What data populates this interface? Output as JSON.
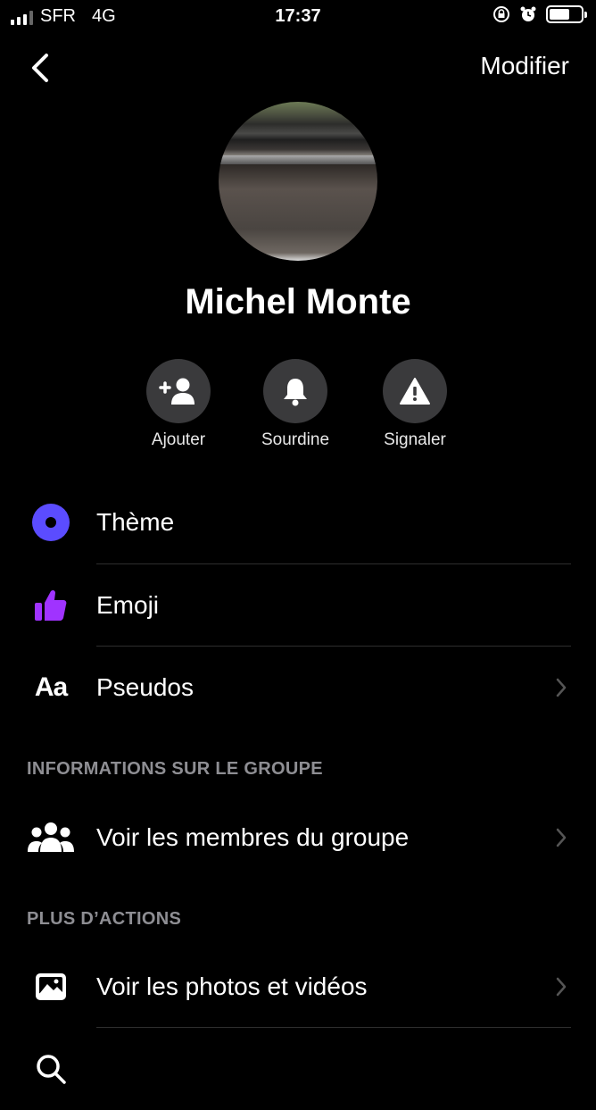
{
  "status_bar": {
    "carrier": "SFR",
    "network": "4G",
    "time": "17:37"
  },
  "nav": {
    "edit_label": "Modifier"
  },
  "profile": {
    "name": "Michel Monte"
  },
  "actions": [
    {
      "label": "Ajouter",
      "icon": "add-person-icon"
    },
    {
      "label": "Sourdine",
      "icon": "bell-icon"
    },
    {
      "label": "Signaler",
      "icon": "warning-icon"
    }
  ],
  "settings": {
    "theme_label": "Thème",
    "emoji_label": "Emoji",
    "nicknames_label": "Pseudos",
    "nicknames_icon_text": "Aa"
  },
  "group_info": {
    "header": "INFORMATIONS SUR LE GROUPE",
    "members_label": "Voir les membres du groupe"
  },
  "more_actions": {
    "header": "PLUS D’ACTIONS",
    "media_label": "Voir les photos et vidéos"
  },
  "colors": {
    "accent": "#5b4cff",
    "emoji": "#a033ff",
    "button_bg": "#3a3a3c"
  }
}
